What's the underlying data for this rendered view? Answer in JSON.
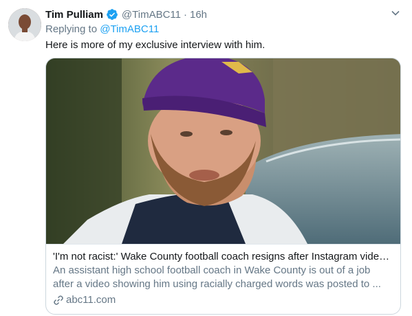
{
  "tweet": {
    "author_name": "Tim Pulliam",
    "handle": "@TimABC11",
    "separator": "·",
    "time": "16h",
    "replying_prefix": "Replying to",
    "replying_to": "@TimABC11",
    "text": "Here is more of my exclusive interview with him.",
    "verified": true
  },
  "card": {
    "title": "'I'm not racist:' Wake County football coach resigns after Instagram video ...",
    "description": "An assistant high school football coach in Wake County is out of a job after a video showing him using racially charged words was posted to ...",
    "domain": "abc11.com"
  },
  "icons": {
    "verified": "verified-badge-icon",
    "menu": "chevron-down-icon",
    "link": "link-icon"
  },
  "colors": {
    "accent": "#1da1f2",
    "secondary_text": "#657786",
    "primary_text": "#14171a",
    "border": "#ccd6dd"
  }
}
